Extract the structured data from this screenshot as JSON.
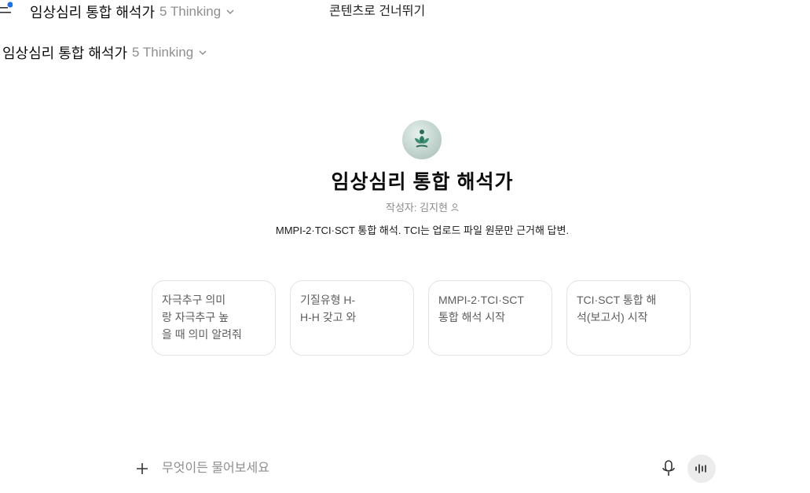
{
  "header": {
    "title": "임상심리 통합 해석가",
    "model": "5 Thinking",
    "skip_link": "콘텐츠로 건너뛰기"
  },
  "subheader": {
    "title": "임상심리 통합 해석가",
    "model": "5 Thinking"
  },
  "gpt": {
    "name": "임상심리 통합 해석가",
    "author": "작성자: 김지현",
    "description": "MMPI-2·TCI·SCT 통합 해석. TCI는 업로드 파일 원문만 근거해 답변."
  },
  "suggestions": [
    {
      "line1": "자극추구 의미",
      "line2": "랑 자극추구 높",
      "line3": "을 때 의미 알려줘"
    },
    {
      "line1": "기질유형 H-",
      "line2": "H-H 갖고 와",
      "line3": ""
    },
    {
      "line1": "MMPI-2·TCI·SCT",
      "line2": "통합 해석 시작",
      "line3": ""
    },
    {
      "line1": "TCI·SCT 통합 해",
      "line2": "석(보고서) 시작",
      "line3": ""
    }
  ],
  "composer": {
    "placeholder": "무엇이든 물어보세요"
  },
  "icons": {
    "menu": "sidebar-menu-icon",
    "chevron": "chevron-down-icon",
    "author": "person-icon",
    "plus": "plus-icon",
    "mic": "microphone-icon",
    "voice": "voice-mode-icon"
  },
  "colors": {
    "notification_dot": "#1a73e8",
    "muted_text": "#8f8f8f",
    "card_border": "#e3e3e3",
    "voice_button_bg": "#ececec"
  }
}
